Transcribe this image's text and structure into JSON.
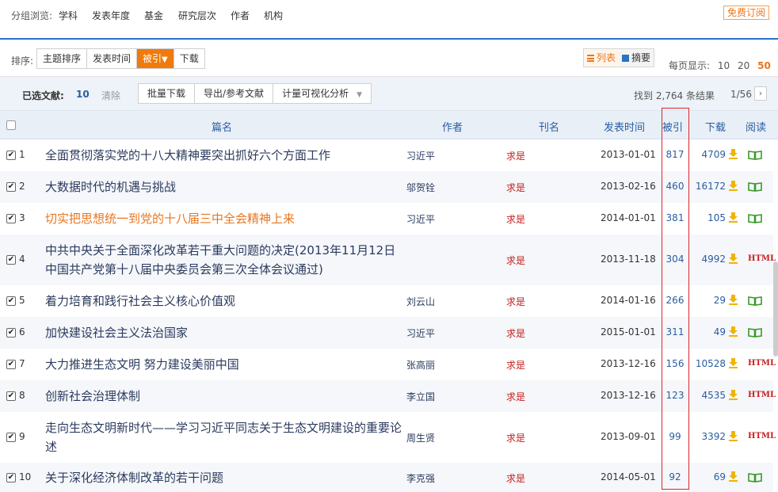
{
  "groupbar": {
    "label": "分组浏览:",
    "groups": [
      "学科",
      "发表年度",
      "基金",
      "研究层次",
      "作者",
      "机构"
    ],
    "subscribe": "免费订阅"
  },
  "sortbar": {
    "label": "排序:",
    "options": [
      "主题排序",
      "发表时间",
      "被引",
      "下载"
    ],
    "active": "被引",
    "view_list": "列表",
    "view_abstract": "摘要",
    "perpage_label": "每页显示:",
    "perpage_options": [
      "10",
      "20",
      "50"
    ],
    "perpage_active": "50"
  },
  "selbar": {
    "selected_label": "已选文献:",
    "selected_count": "10",
    "clear": "清除",
    "actions": [
      "批量下载",
      "导出/参考文献",
      "计量可视化分析"
    ],
    "found": "找到 2,764 条结果",
    "page": "1/56",
    "next": "›"
  },
  "table": {
    "headers": {
      "title": "篇名",
      "author": "作者",
      "source": "刊名",
      "date": "发表时间",
      "cite": "被引",
      "download": "下载",
      "read": "阅读"
    },
    "rows": [
      {
        "num": "1",
        "title": "全面贯彻落实党的十八大精神要突出抓好六个方面工作",
        "author": "习近平",
        "source": "求是",
        "date": "2013-01-01",
        "cite": "817",
        "download": "4709",
        "read": "book"
      },
      {
        "num": "2",
        "title": "大数据时代的机遇与挑战",
        "author": "邬贺铨",
        "source": "求是",
        "date": "2013-02-16",
        "cite": "460",
        "download": "16172",
        "read": "book"
      },
      {
        "num": "3",
        "title": "切实把思想统一到党的十八届三中全会精神上来",
        "author": "习近平",
        "source": "求是",
        "date": "2014-01-01",
        "cite": "381",
        "download": "105",
        "read": "book"
      },
      {
        "num": "4",
        "title": "中共中央关于全面深化改革若干重大问题的决定(2013年11月12日中国共产党第十八届中央委员会第三次全体会议通过)",
        "author": "",
        "source": "求是",
        "date": "2013-11-18",
        "cite": "304",
        "download": "4992",
        "read": "HTML"
      },
      {
        "num": "5",
        "title": "着力培育和践行社会主义核心价值观",
        "author": "刘云山",
        "source": "求是",
        "date": "2014-01-16",
        "cite": "266",
        "download": "29",
        "read": "book"
      },
      {
        "num": "6",
        "title": "加快建设社会主义法治国家",
        "author": "习近平",
        "source": "求是",
        "date": "2015-01-01",
        "cite": "311",
        "download": "49",
        "read": "book"
      },
      {
        "num": "7",
        "title": "大力推进生态文明 努力建设美丽中国",
        "author": "张高丽",
        "source": "求是",
        "date": "2013-12-16",
        "cite": "156",
        "download": "10528",
        "read": "HTML"
      },
      {
        "num": "8",
        "title": "创新社会治理体制",
        "author": "李立国",
        "source": "求是",
        "date": "2013-12-16",
        "cite": "123",
        "download": "4535",
        "read": "HTML"
      },
      {
        "num": "9",
        "title": "走向生态文明新时代——学习习近平同志关于生态文明建设的重要论述",
        "author": "周生贤",
        "source": "求是",
        "date": "2013-09-01",
        "cite": "99",
        "download": "3392",
        "read": "HTML"
      },
      {
        "num": "10",
        "title": "关于深化经济体制改革的若干问题",
        "author": "李克强",
        "source": "求是",
        "date": "2014-05-01",
        "cite": "92",
        "download": "69",
        "read": "book"
      }
    ]
  },
  "colors": {
    "accent_orange": "#f07a0c",
    "link_blue": "#2a5d9f",
    "source_red": "#c62020",
    "highlight_red": "#d9272e"
  }
}
